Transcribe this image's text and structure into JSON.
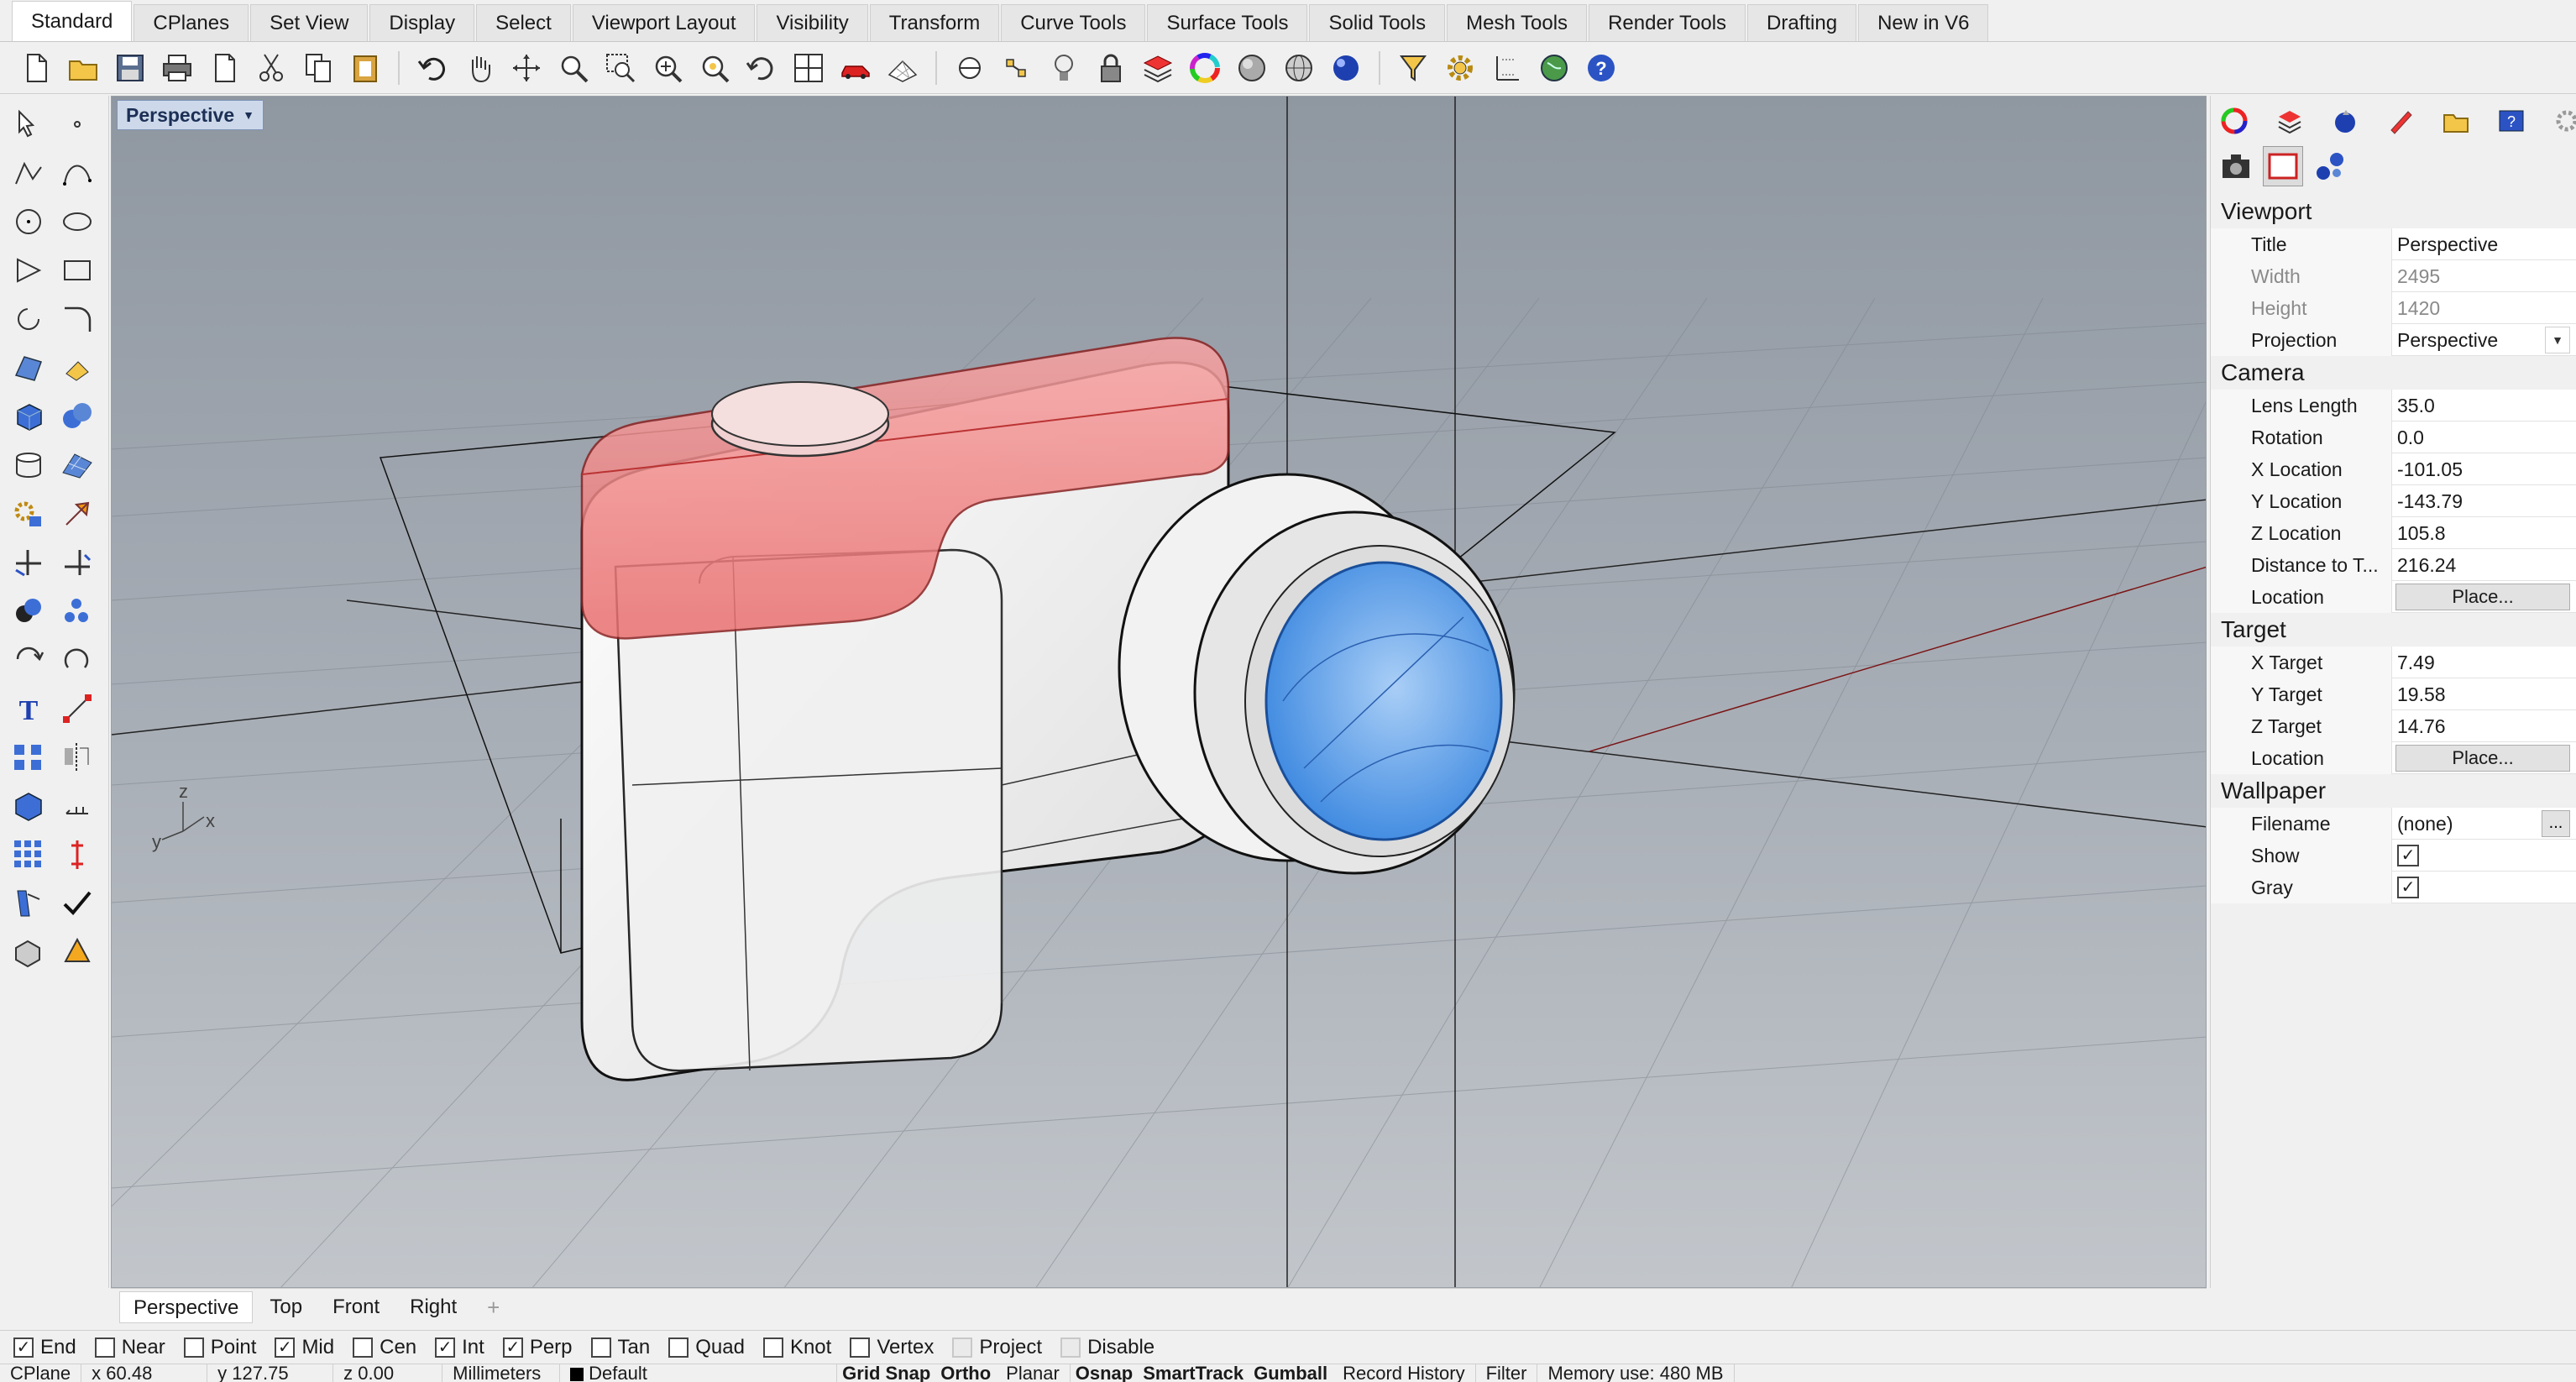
{
  "tabs": [
    "Standard",
    "CPlanes",
    "Set View",
    "Display",
    "Select",
    "Viewport Layout",
    "Visibility",
    "Transform",
    "Curve Tools",
    "Surface Tools",
    "Solid Tools",
    "Mesh Tools",
    "Render Tools",
    "Drafting",
    "New in V6"
  ],
  "active_tab": "Standard",
  "viewport": {
    "title": "Perspective",
    "axis_labels": {
      "x": "x",
      "y": "y",
      "z": "z"
    }
  },
  "viewport_tabs": [
    "Perspective",
    "Top",
    "Front",
    "Right"
  ],
  "add_tab_icon": "+",
  "osnaps": [
    {
      "label": "End",
      "checked": true
    },
    {
      "label": "Near",
      "checked": false
    },
    {
      "label": "Point",
      "checked": false
    },
    {
      "label": "Mid",
      "checked": true
    },
    {
      "label": "Cen",
      "checked": false
    },
    {
      "label": "Int",
      "checked": true
    },
    {
      "label": "Perp",
      "checked": true
    },
    {
      "label": "Tan",
      "checked": false
    },
    {
      "label": "Quad",
      "checked": false
    },
    {
      "label": "Knot",
      "checked": false
    },
    {
      "label": "Vertex",
      "checked": false
    },
    {
      "label": "Project",
      "checked": false,
      "disabled": true
    },
    {
      "label": "Disable",
      "checked": false,
      "disabled": true
    }
  ],
  "status": {
    "cplane": "CPlane",
    "x": "x 60.48",
    "y": "y 127.75",
    "z": "z 0.00",
    "units": "Millimeters",
    "layer": "Default",
    "toggles": [
      "Grid Snap",
      "Ortho",
      "Planar",
      "Osnap",
      "SmartTrack",
      "Gumball",
      "Record History",
      "Filter",
      "Memory use: 480 MB"
    ]
  },
  "panel": {
    "sections": {
      "viewport": "Viewport",
      "camera": "Camera",
      "target": "Target",
      "wallpaper": "Wallpaper"
    },
    "viewport_props": {
      "title_label": "Title",
      "title_value": "Perspective",
      "width_label": "Width",
      "width_value": "2495",
      "height_label": "Height",
      "height_value": "1420",
      "projection_label": "Projection",
      "projection_value": "Perspective"
    },
    "camera_props": {
      "lens_label": "Lens Length",
      "lens_value": "35.0",
      "rotation_label": "Rotation",
      "rotation_value": "0.0",
      "xloc_label": "X Location",
      "xloc_value": "-101.05",
      "yloc_label": "Y Location",
      "yloc_value": "-143.79",
      "zloc_label": "Z Location",
      "zloc_value": "105.8",
      "dist_label": "Distance to T...",
      "dist_value": "216.24",
      "loc_label": "Location",
      "loc_button": "Place..."
    },
    "target_props": {
      "xt_label": "X Target",
      "xt_value": "7.49",
      "yt_label": "Y Target",
      "yt_value": "19.58",
      "zt_label": "Z Target",
      "zt_value": "14.76",
      "loc_label": "Location",
      "loc_button": "Place..."
    },
    "wallpaper_props": {
      "filename_label": "Filename",
      "filename_value": "(none)",
      "filename_button": "...",
      "show_label": "Show",
      "show_checked": true,
      "gray_label": "Gray",
      "gray_checked": true
    }
  },
  "colors": {
    "viewport_bg": "#a3aab3",
    "camera_top": "#ee8a8a",
    "lens_glass": "#7fb3ee",
    "body": "#f3f3f3"
  }
}
